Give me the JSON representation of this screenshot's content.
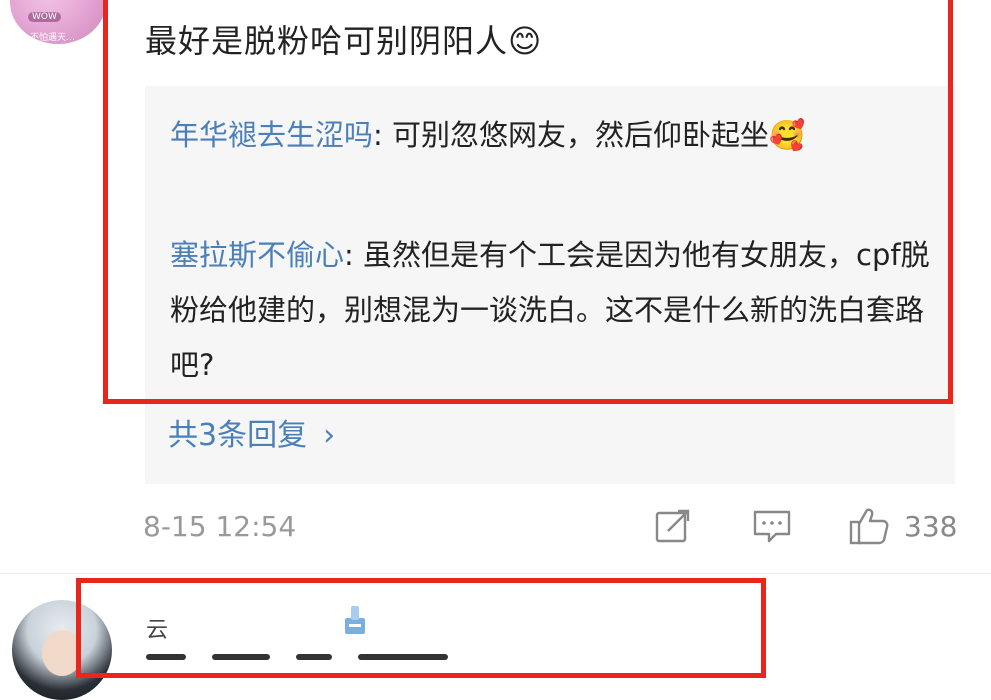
{
  "first_comment": {
    "avatar_caption": "不怕遇天…",
    "avatar_badge": "WOW",
    "text": "最好是脱粉哈可别阴阳人😊",
    "replies": [
      {
        "username": "年华褪去生涩吗",
        "separator": ": ",
        "text": "可别忽悠网友，然后仰卧起坐🥰"
      },
      {
        "username": "塞拉斯不偷心",
        "separator": ": ",
        "text": "虽然但是有个工会是因为他有女朋友，cpf脱粉给他建的，别想混为一谈洗白。这不是什么新的洗白套路吧?"
      }
    ],
    "more_replies_label": "共3条回复",
    "more_replies_chevron": "›",
    "timestamp": "8-15 12:54",
    "like_count": "338",
    "icons": {
      "share": "share-icon",
      "comment": "comment-icon",
      "like": "thumbs-up-icon"
    }
  },
  "second_comment": {
    "username": "云"
  },
  "colors": {
    "highlight": "#e8261c",
    "link": "#4a7fb8",
    "muted": "#999999",
    "reply_bg": "#f6f6f6"
  }
}
